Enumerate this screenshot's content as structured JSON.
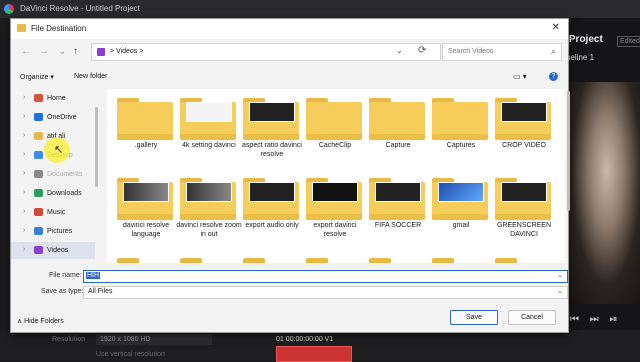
{
  "background_app": {
    "window_title": "DaVinci Resolve - Untitled Project",
    "project_title": "d Project",
    "edited_badge": "Edited",
    "timeline_label": "neline 1",
    "resolution_label": "Resolution",
    "resolution_value": "1920 x 1080 HD",
    "vertical_resolution": "Use vertical resolution",
    "timecode": "01  00:00:00:00   V1",
    "playback_controls": "⏮ ⏭ ⏯"
  },
  "dialog": {
    "title": "File Destination",
    "close_glyph": "✕",
    "nav": {
      "back": "←",
      "forward": "→",
      "recent": "⌄",
      "up": "↑"
    },
    "breadcrumb": ">  Videos  >",
    "dropdown_glyph": "⌄",
    "refresh_glyph": "⟳",
    "search_placeholder": "Search Videos",
    "organize": "Organize ▾",
    "new_folder": "New folder",
    "view_glyph": "▭ ▾",
    "help_glyph": "?",
    "sidebar": [
      {
        "label": "Home",
        "icon": "home-icon",
        "color": "#d4553b"
      },
      {
        "label": "OneDrive",
        "icon": "onedrive-icon",
        "color": "#1f72d8"
      },
      {
        "label": "atif ali",
        "icon": "folder-icon",
        "color": "#e5b94a"
      },
      {
        "label": "Desktop",
        "icon": "desktop-icon",
        "color": "#3a8ee6"
      },
      {
        "label": "Documents",
        "icon": "documents-icon",
        "color": "#8a8a8a"
      },
      {
        "label": "Downloads",
        "icon": "downloads-icon",
        "color": "#2a9d5e"
      },
      {
        "label": "Music",
        "icon": "music-icon",
        "color": "#d24a3a"
      },
      {
        "label": "Pictures",
        "icon": "pictures-icon",
        "color": "#3a7fd6"
      },
      {
        "label": "Videos",
        "icon": "videos-icon",
        "color": "#8b3fd1"
      }
    ],
    "files": [
      {
        "name": ".gallery",
        "thumb": ""
      },
      {
        "name": "4k setting davinci",
        "thumb": "light"
      },
      {
        "name": "aspect ratio davinci resolve",
        "thumb": "dark"
      },
      {
        "name": "CacheClip",
        "thumb": ""
      },
      {
        "name": "Capture",
        "thumb": ""
      },
      {
        "name": "Captures",
        "thumb": ""
      },
      {
        "name": "CROP VIDEO",
        "thumb": "dark"
      },
      {
        "name": "davinci resolve language",
        "thumb": "dark2"
      },
      {
        "name": "davinci resolve zoom in out",
        "thumb": "dark2"
      },
      {
        "name": "export audio only",
        "thumb": "dark"
      },
      {
        "name": "export davinci resolve",
        "thumb": "red"
      },
      {
        "name": "FIFA SOCCER",
        "thumb": "dark"
      },
      {
        "name": "gmail",
        "thumb": "blue"
      },
      {
        "name": "GREENSCREEN DAVINCI",
        "thumb": "dark"
      }
    ],
    "file_name_label": "File name:",
    "file_name_value": "HIH",
    "save_type_label": "Save as type:",
    "save_type_value": "All Files",
    "hide_folders": "Hide Folders",
    "save_button": "Save",
    "cancel_button": "Cancel"
  }
}
